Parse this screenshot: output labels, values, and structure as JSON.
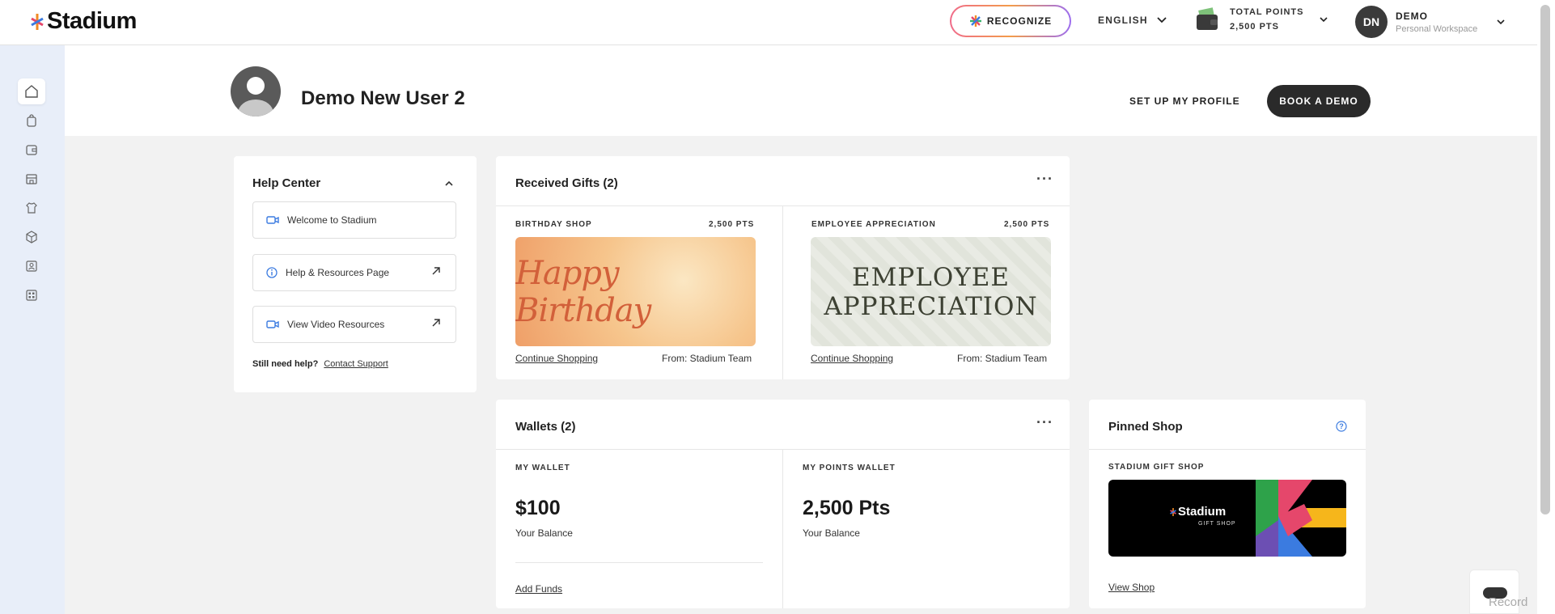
{
  "app": {
    "logo_text": "Stadium"
  },
  "topbar": {
    "recognize_label": "RECOGNIZE",
    "language": "ENGLISH",
    "points_title": "TOTAL POINTS",
    "points_value": "2,500 PTS",
    "user_initials": "DN",
    "user_name": "DEMO",
    "workspace": "Personal Workspace"
  },
  "sidebar": {
    "items": [
      "home-icon",
      "shopping-bag-icon",
      "wallet-icon",
      "store-icon",
      "shirt-icon",
      "box-icon",
      "contacts-icon",
      "grid-icon"
    ]
  },
  "profile": {
    "name": "Demo New User 2",
    "setup_label": "SET UP MY PROFILE",
    "book_demo_label": "BOOK A DEMO"
  },
  "help_center": {
    "title": "Help Center",
    "items": [
      {
        "label": "Welcome to Stadium",
        "icon": "video-icon"
      },
      {
        "label": "Help & Resources Page",
        "icon": "info-icon"
      },
      {
        "label": "View Video Resources",
        "icon": "video-icon"
      }
    ],
    "still_need": "Still need help?",
    "contact": "Contact Support"
  },
  "received_gifts": {
    "title": "Received Gifts (2)",
    "more": "···",
    "gifts": [
      {
        "shop": "BIRTHDAY SHOP",
        "points": "2,500 PTS",
        "image_text": "Happy Birthday",
        "action": "Continue Shopping",
        "from": "From: Stadium Team"
      },
      {
        "shop": "EMPLOYEE APPRECIATION",
        "points": "2,500 PTS",
        "image_text_1": "EMPLOYEE",
        "image_text_2": "APPRECIATION",
        "action": "Continue Shopping",
        "from": "From: Stadium Team"
      }
    ]
  },
  "wallets": {
    "title": "Wallets (2)",
    "more": "···",
    "items": [
      {
        "label": "MY WALLET",
        "amount": "$100",
        "sub": "Your Balance",
        "action": "Add Funds"
      },
      {
        "label": "MY POINTS WALLET",
        "amount": "2,500 Pts",
        "sub": "Your Balance"
      }
    ]
  },
  "pinned_shop": {
    "title": "Pinned Shop",
    "shop_label": "STADIUM GIFT SHOP",
    "logo_text": "Stadium",
    "logo_sub": "GIFT SHOP",
    "action": "View Shop"
  },
  "record": {
    "label": "Record"
  }
}
